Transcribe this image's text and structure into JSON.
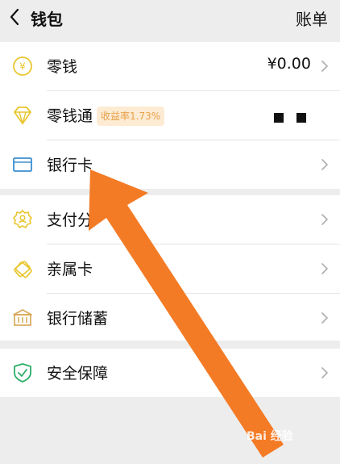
{
  "header": {
    "title": "钱包",
    "bills_label": "账单"
  },
  "wallet": {
    "change_label": "零钱",
    "change_value": "¥0.00",
    "lingqiantong_label": "零钱通",
    "lingqiantong_badge": "收益率1.73%",
    "bank_card_label": "银行卡"
  },
  "services": {
    "pay_score_label": "支付分",
    "family_card_label": "亲属卡",
    "bank_savings_label": "银行储蓄"
  },
  "security": {
    "label": "安全保障"
  },
  "watermark": "Bai 经验",
  "colors": {
    "yellow_icon": "#e9c62f",
    "blue_icon": "#3a8fd1",
    "green_icon": "#2aae67",
    "arrow": "#f47b25"
  }
}
